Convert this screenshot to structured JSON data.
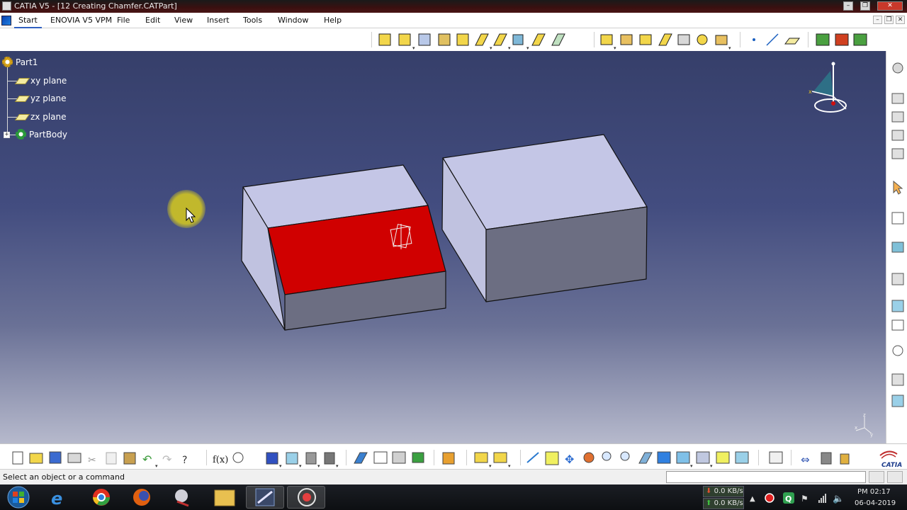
{
  "window": {
    "title": "CATIA V5 - [12 Creating Chamfer.CATPart]"
  },
  "menubar": {
    "items": [
      {
        "label": "Start"
      },
      {
        "label": "ENOVIA V5 VPM"
      },
      {
        "label": "File"
      },
      {
        "label": "Edit"
      },
      {
        "label": "View"
      },
      {
        "label": "Insert"
      },
      {
        "label": "Tools"
      },
      {
        "label": "Window"
      },
      {
        "label": "Help"
      }
    ]
  },
  "tree": {
    "root": "Part1",
    "children": [
      {
        "label": "xy plane",
        "icon": "plane-icon"
      },
      {
        "label": "yz plane",
        "icon": "plane-icon"
      },
      {
        "label": "zx plane",
        "icon": "plane-icon"
      },
      {
        "label": "PartBody",
        "icon": "partbody-gear-icon"
      }
    ]
  },
  "viewport": {
    "selected_face_color": "#cc0000",
    "solid_top_color": "#c4c6e6",
    "solid_side_color": "#6c6e82"
  },
  "statusbar": {
    "message": "Select an object or a command",
    "command_value": ""
  },
  "taskbar": {
    "net_down": "0.0 KB/s",
    "net_up": "0.0 KB/s",
    "time": "PM 02:17",
    "date": "06-04-2019"
  },
  "brand": {
    "logo_text": "CATIA"
  }
}
